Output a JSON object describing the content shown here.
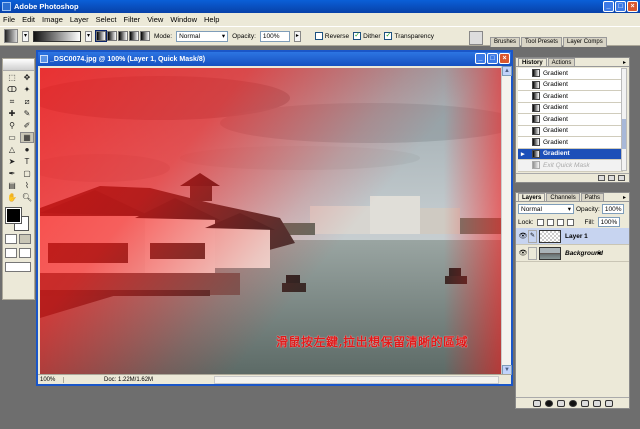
{
  "app": {
    "title": "Adobe Photoshop"
  },
  "menu": [
    "File",
    "Edit",
    "Image",
    "Layer",
    "Select",
    "Filter",
    "View",
    "Window",
    "Help"
  ],
  "options": {
    "mode_label": "Mode:",
    "mode_value": "Normal",
    "opacity_label": "Opacity:",
    "opacity_value": "100%",
    "reverse_label": "Reverse",
    "dither_label": "Dither",
    "transparency_label": "Transparency",
    "reverse_checked": false,
    "dither_checked": true,
    "transparency_checked": true
  },
  "palette_well": {
    "tabs": [
      "Brushes",
      "Tool Presets",
      "Layer Comps"
    ]
  },
  "document": {
    "title": "_DSC0074.jpg @ 100% (Layer 1, Quick Mask/8)",
    "zoom": "100%",
    "doc_info": "Doc: 1.22M/1.62M",
    "caption": "滑鼠按左鍵,拉出想保留清晰的區域"
  },
  "history": {
    "tabs": [
      "History",
      "Actions"
    ],
    "items": [
      {
        "label": "Gradient",
        "state": "normal"
      },
      {
        "label": "Gradient",
        "state": "normal"
      },
      {
        "label": "Gradient",
        "state": "normal"
      },
      {
        "label": "Gradient",
        "state": "normal"
      },
      {
        "label": "Gradient",
        "state": "normal"
      },
      {
        "label": "Gradient",
        "state": "normal"
      },
      {
        "label": "Gradient",
        "state": "normal"
      },
      {
        "label": "Gradient",
        "state": "selected"
      },
      {
        "label": "Exit Quick Mask",
        "state": "dimmed"
      }
    ]
  },
  "layers": {
    "tabs": [
      "Layers",
      "Channels",
      "Paths"
    ],
    "blend_mode": "Normal",
    "opacity_label": "Opacity:",
    "opacity_value": "100%",
    "lock_label": "Lock:",
    "fill_label": "Fill:",
    "fill_value": "100%",
    "items": [
      {
        "name": "Layer 1",
        "selected": true,
        "italic": false,
        "locked": false
      },
      {
        "name": "Background",
        "selected": false,
        "italic": true,
        "locked": true
      }
    ]
  },
  "colors": {
    "titlebar": "#0841a8",
    "chrome": "#ece9d8",
    "mask": "#e21a1a",
    "selection": "#1c4fb8"
  }
}
